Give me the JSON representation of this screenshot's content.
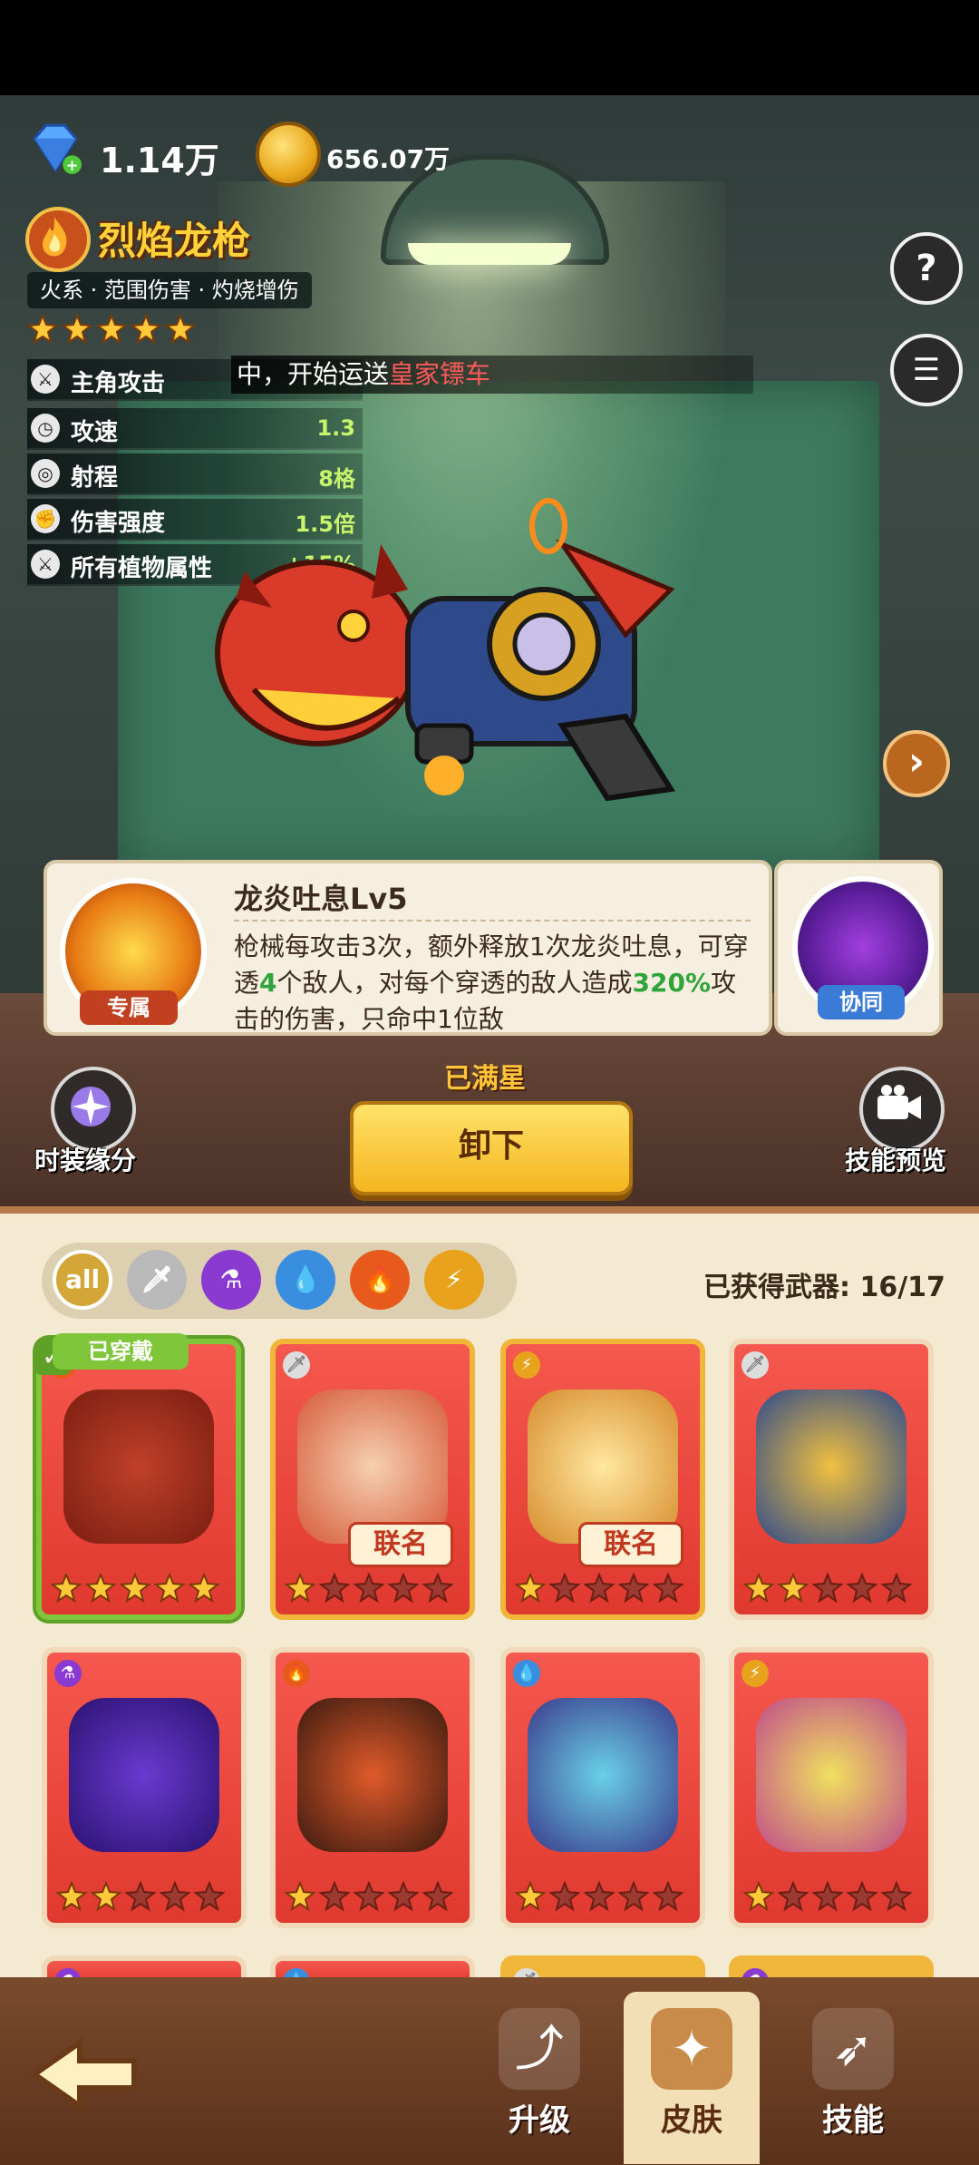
{
  "currency": {
    "gems": "1.14万",
    "coins": "656.07万"
  },
  "weapon": {
    "name": "烈焰龙枪",
    "tags": "火系 · 范围伤害 · 灼烧增伤",
    "stars": 5,
    "stats": [
      {
        "label": "主角攻击",
        "value": ""
      },
      {
        "label": "攻速",
        "value": "1.3"
      },
      {
        "label": "射程",
        "value": "8格"
      },
      {
        "label": "伤害强度",
        "value": "1.5倍"
      },
      {
        "label": "所有植物属性",
        "value": "+15%"
      }
    ]
  },
  "marquee": {
    "text": "中，开始运送",
    "highlight": "皇家镖车"
  },
  "skill": {
    "title": "龙炎吐息Lv5",
    "tag": "专属",
    "desc_1": "枪械每攻击3次，额外释放1次龙炎吐息，可穿透",
    "desc_2": "4",
    "desc_3": "个敌人，对每个穿透的敌人造成",
    "desc_4": "320%",
    "desc_5": "攻击的伤害，只命中1位敌"
  },
  "synergy": {
    "tag": "协同"
  },
  "max_star_text": "已满星",
  "unequip_label": "卸下",
  "outfit_label": "时装缘分",
  "preview_label": "技能预览",
  "filters": [
    "all",
    "sword",
    "poison",
    "water",
    "fire",
    "thunder"
  ],
  "obtained": "已获得武器: 16/17",
  "worn_label": "已穿戴",
  "collab_label": "联名",
  "cards_row1": [
    {
      "element": "fire",
      "stars": 5,
      "worn": true,
      "collab": false
    },
    {
      "element": "sword",
      "stars": 1,
      "worn": false,
      "collab": true
    },
    {
      "element": "thunder",
      "stars": 1,
      "worn": false,
      "collab": true
    },
    {
      "element": "sword",
      "stars": 2,
      "worn": false,
      "collab": false
    }
  ],
  "cards_row2": [
    {
      "element": "poison",
      "stars": 2
    },
    {
      "element": "fire",
      "stars": 1
    },
    {
      "element": "water",
      "stars": 1
    },
    {
      "element": "thunder",
      "stars": 1
    }
  ],
  "nav": {
    "upgrade": "升级",
    "skin": "皮肤",
    "skill": "技能"
  },
  "colors": {
    "accent": "#ffd23a",
    "card_red": "#e0392f",
    "green": "#7fc63a"
  }
}
